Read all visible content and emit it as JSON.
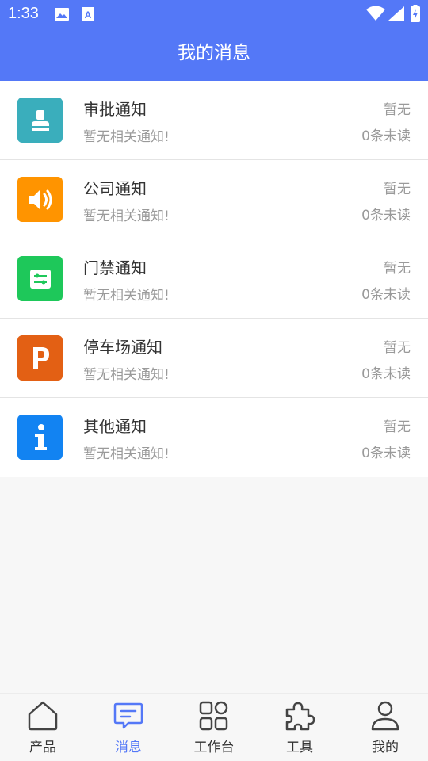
{
  "status_bar": {
    "time": "1:33"
  },
  "header": {
    "title": "我的消息"
  },
  "notifications": [
    {
      "title": "审批通知",
      "subtitle": "暂无相关通知!",
      "status": "暂无",
      "unread": "0条未读",
      "icon": "stamp-icon",
      "color": "#3aaebc"
    },
    {
      "title": "公司通知",
      "subtitle": "暂无相关通知!",
      "status": "暂无",
      "unread": "0条未读",
      "icon": "speaker-icon",
      "color": "#ff9400"
    },
    {
      "title": "门禁通知",
      "subtitle": "暂无相关通知!",
      "status": "暂无",
      "unread": "0条未读",
      "icon": "access-control-icon",
      "color": "#1ec85a"
    },
    {
      "title": "停车场通知",
      "subtitle": "暂无相关通知!",
      "status": "暂无",
      "unread": "0条未读",
      "icon": "parking-icon",
      "color": "#e36014"
    },
    {
      "title": "其他通知",
      "subtitle": "暂无相关通知!",
      "status": "暂无",
      "unread": "0条未读",
      "icon": "info-icon",
      "color": "#1283f2"
    }
  ],
  "tabbar": {
    "active": "消息",
    "active_color": "#5478f7",
    "tabs": [
      {
        "label": "产品",
        "icon": "home-icon"
      },
      {
        "label": "消息",
        "icon": "message-icon"
      },
      {
        "label": "工作台",
        "icon": "grid-icon"
      },
      {
        "label": "工具",
        "icon": "puzzle-icon"
      },
      {
        "label": "我的",
        "icon": "user-icon"
      }
    ]
  }
}
